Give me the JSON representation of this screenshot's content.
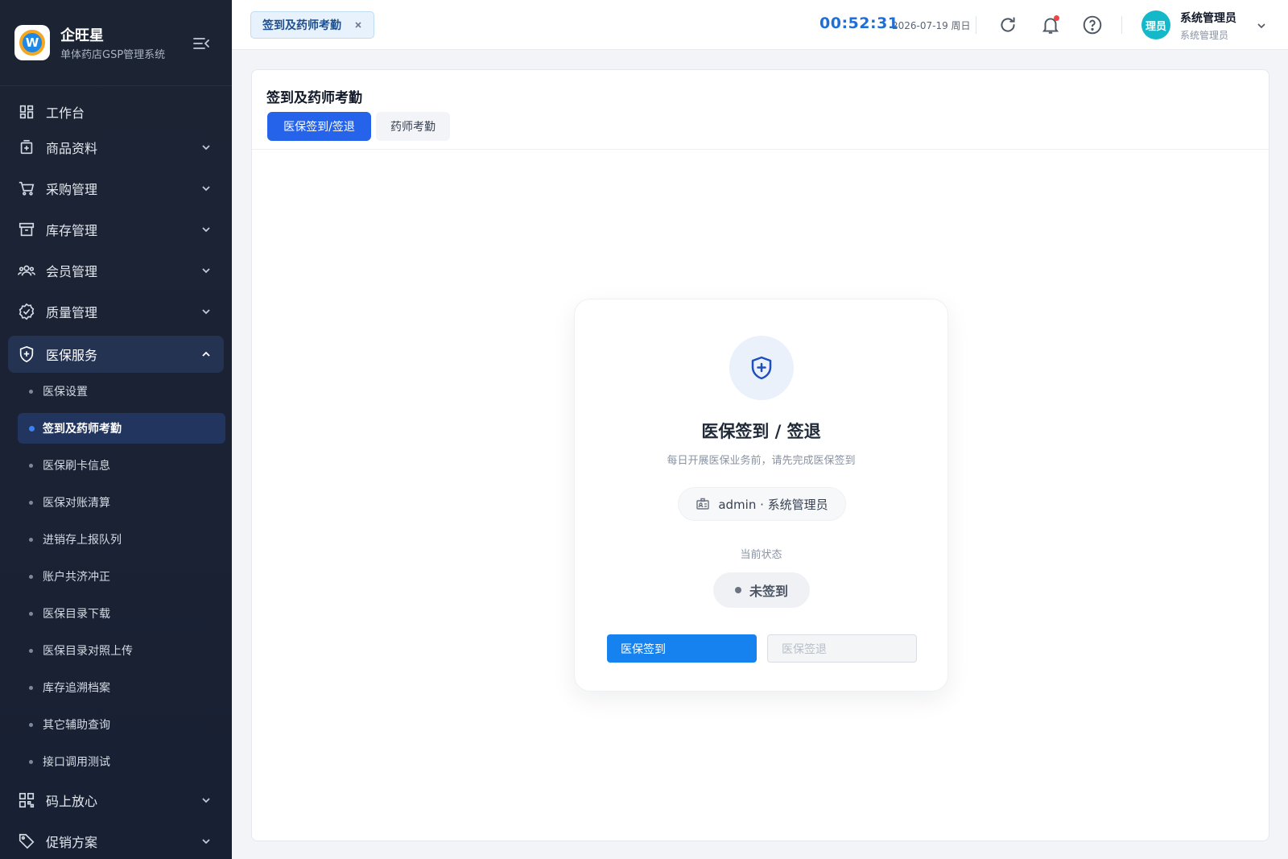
{
  "brand": {
    "logo_letter": "W",
    "title": "企旺星",
    "subtitle": "单体药店GSP管理系统"
  },
  "sidebar": {
    "items": [
      {
        "label": "工作台",
        "icon": "dashboard-icon"
      },
      {
        "label": "商品资料",
        "icon": "medicine-box-icon"
      },
      {
        "label": "采购管理",
        "icon": "cart-icon"
      },
      {
        "label": "库存管理",
        "icon": "archive-icon"
      },
      {
        "label": "会员管理",
        "icon": "members-icon"
      },
      {
        "label": "质量管理",
        "icon": "badge-check-icon"
      },
      {
        "label": "医保服务",
        "icon": "shield-plus-icon"
      },
      {
        "label": "码上放心",
        "icon": "qr-code-icon"
      },
      {
        "label": "促销方案",
        "icon": "tag-icon"
      }
    ],
    "sub_items": [
      "医保设置",
      "签到及药师考勤",
      "医保刷卡信息",
      "医保对账清算",
      "进销存上报队列",
      "账户共济冲正",
      "医保目录下载",
      "医保目录对照上传",
      "库存追溯档案",
      "其它辅助查询",
      "接口调用测试"
    ],
    "active_sub": "签到及药师考勤"
  },
  "header": {
    "open_tab": "签到及药师考勤",
    "clock": "00:52:31",
    "date": "2026-07-19 周日",
    "avatar_text": "理员",
    "user_name": "系统管理员",
    "user_role": "系统管理员"
  },
  "page": {
    "title": "签到及药师考勤",
    "tabs": [
      "医保签到/签退",
      "药师考勤"
    ],
    "active_tab": "医保签到/签退"
  },
  "card": {
    "title": "医保签到 / 签退",
    "subtitle": "每日开展医保业务前，请先完成医保签到",
    "operator": "admin · 系统管理员",
    "state_label": "当前状态",
    "status": "未签到",
    "checkin_label": "医保签到",
    "checkout_label": "医保签退"
  },
  "colors": {
    "primary": "#2563eb",
    "clock": "#1e6fd9",
    "sidebar_bg": "#1c2434",
    "avatar": "#15b8c9",
    "notification": "#ef4444"
  }
}
